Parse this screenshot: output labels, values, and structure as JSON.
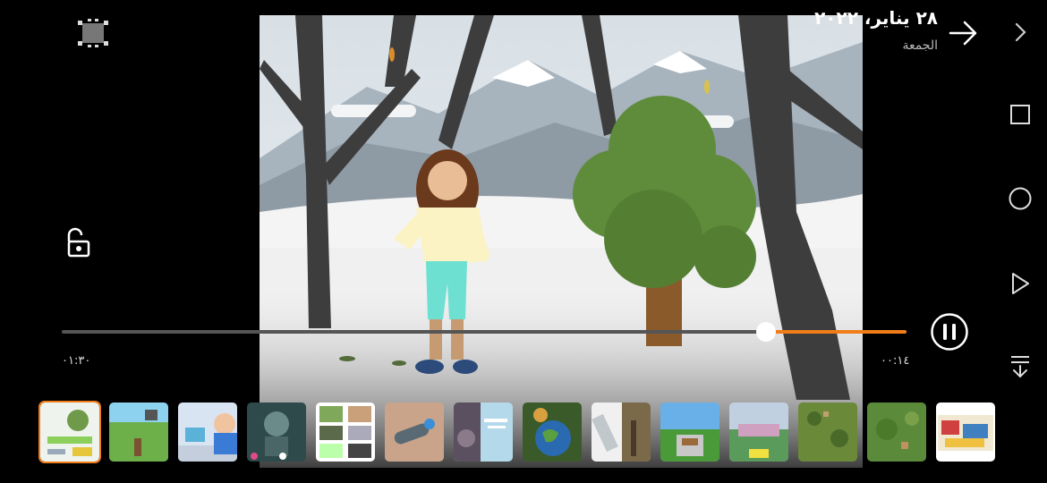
{
  "header": {
    "date_title": "٢٨ يناير، ٢٠٢٢",
    "day_label": "الجمعة"
  },
  "player": {
    "time_start": "٠١:٣٠",
    "time_end": "٠٠:١٤",
    "progress_fraction": 0.83,
    "state": "playing"
  },
  "icons": {
    "top_left": "crop-frame-icon",
    "lock": "unlock-icon",
    "forward": "arrow-right-icon",
    "pause": "pause-icon",
    "nav_back": "chevron-right-icon",
    "nav_recents": "square-icon",
    "nav_home": "circle-icon",
    "nav_play": "triangle-icon",
    "collapse": "collapse-down-icon"
  },
  "thumbnails": [
    {
      "name": "thumbnail-1",
      "selected": true
    },
    {
      "name": "thumbnail-2",
      "selected": false
    },
    {
      "name": "thumbnail-3",
      "selected": false
    },
    {
      "name": "thumbnail-4",
      "selected": false
    },
    {
      "name": "thumbnail-5",
      "selected": false
    },
    {
      "name": "thumbnail-6",
      "selected": false
    },
    {
      "name": "thumbnail-7",
      "selected": false
    },
    {
      "name": "thumbnail-8",
      "selected": false
    },
    {
      "name": "thumbnail-9",
      "selected": false
    },
    {
      "name": "thumbnail-10",
      "selected": false
    },
    {
      "name": "thumbnail-11",
      "selected": false
    },
    {
      "name": "thumbnail-12",
      "selected": false
    },
    {
      "name": "thumbnail-13",
      "selected": false
    },
    {
      "name": "thumbnail-14",
      "selected": false
    }
  ],
  "colors": {
    "accent": "#f07d1a",
    "background": "#000000"
  }
}
